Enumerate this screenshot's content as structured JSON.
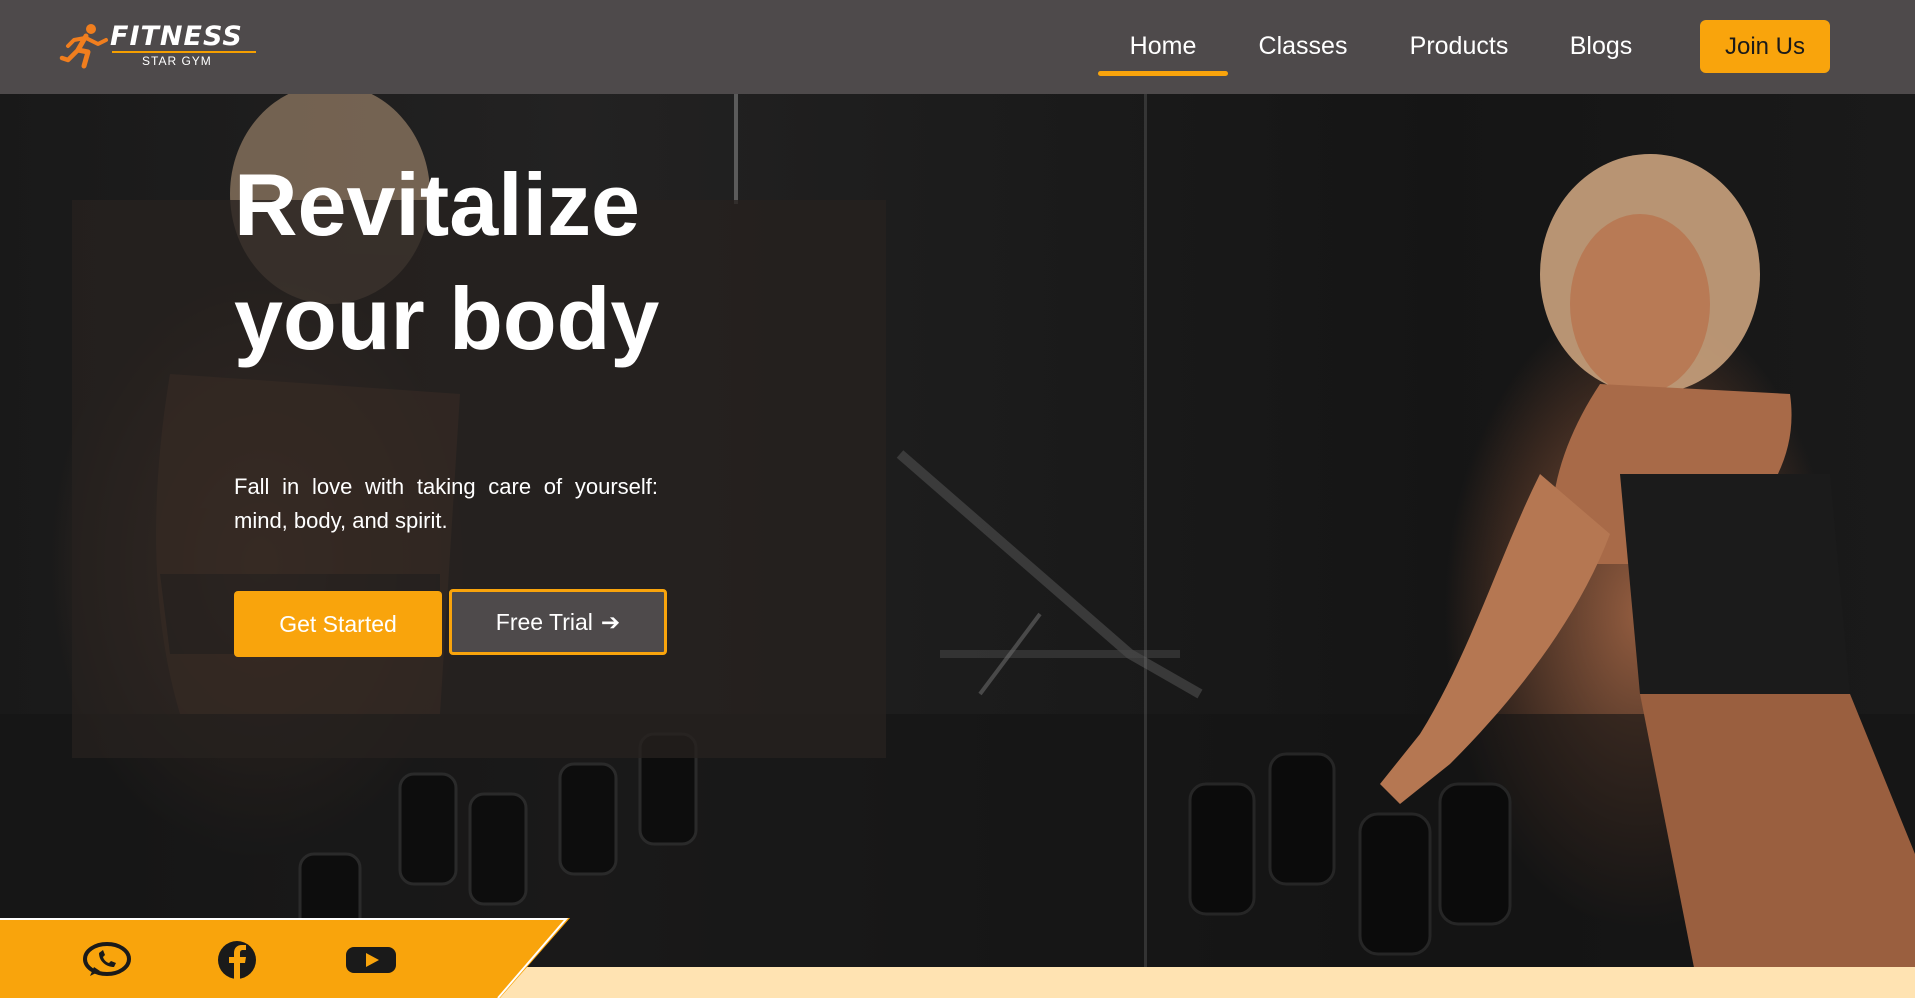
{
  "brand": {
    "name": "FITNESS",
    "tagline": "STAR GYM",
    "accent_color": "#f9a40c",
    "nav_color": "#4e4a4b"
  },
  "nav": {
    "links": [
      {
        "label": "Home",
        "active": true
      },
      {
        "label": "Classes",
        "active": false
      },
      {
        "label": "Products",
        "active": false
      },
      {
        "label": "Blogs",
        "active": false
      }
    ],
    "cta_label": "Join Us"
  },
  "hero": {
    "title_line1": "Revitalize",
    "title_line2": "your body",
    "description": "Fall in love with taking care of yourself: mind, body, and spirit.",
    "primary_button": "Get Started",
    "secondary_button": "Free Trial",
    "secondary_button_icon": "➔"
  },
  "social": {
    "icons": [
      "whatsapp-icon",
      "facebook-icon",
      "youtube-icon"
    ],
    "bar_color": "#f9a40c",
    "strip_color": "#ffe3b2"
  }
}
